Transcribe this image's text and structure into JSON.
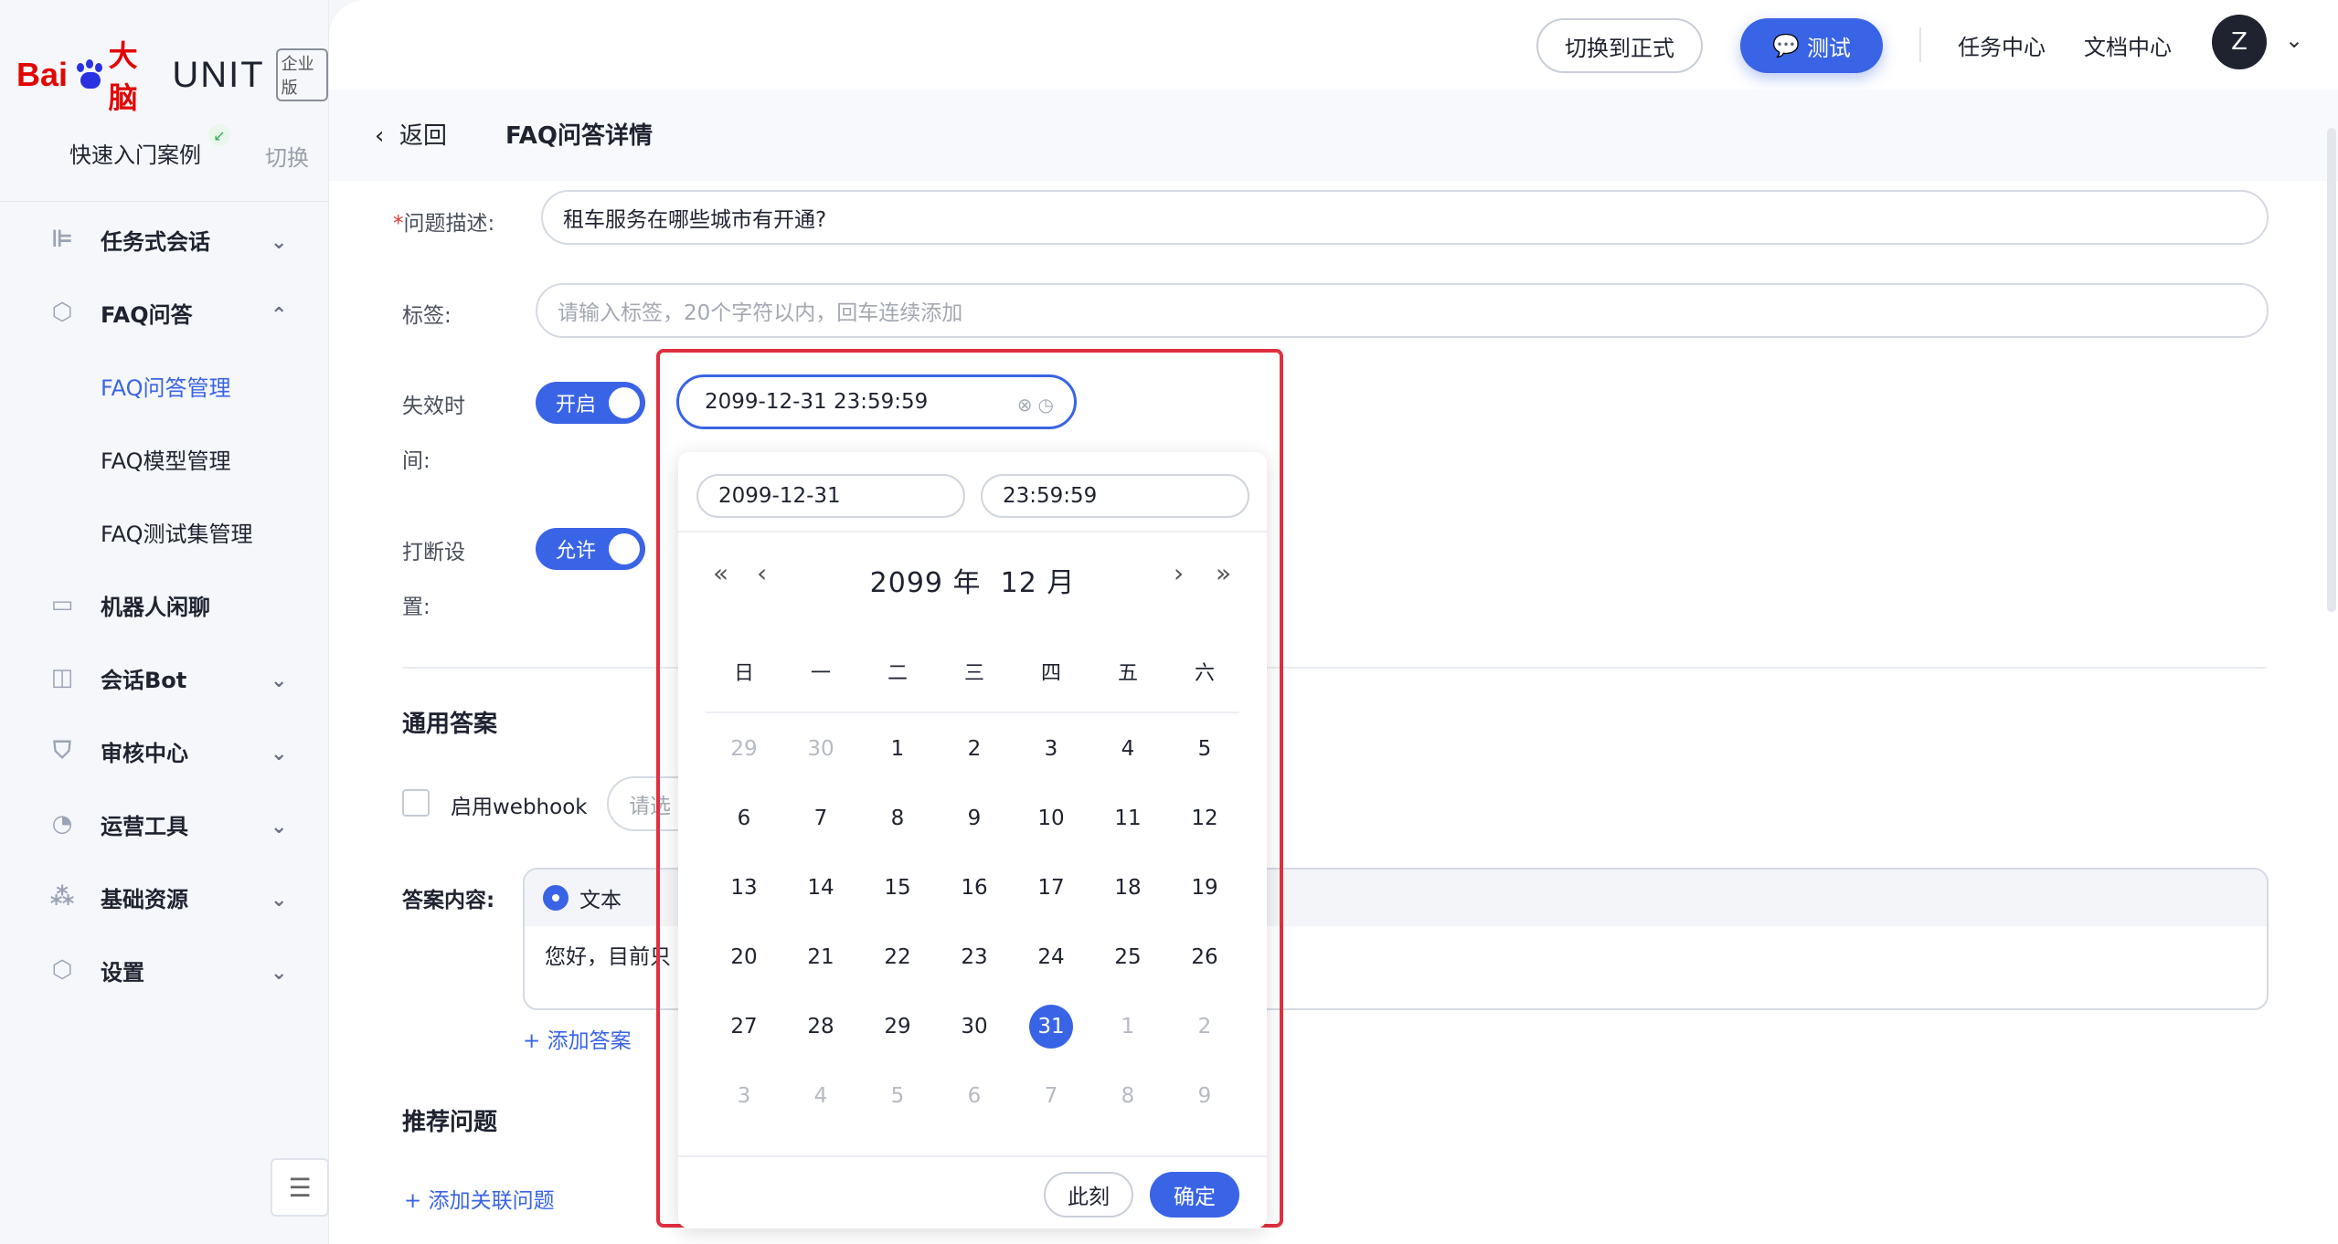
{
  "brand": {
    "bai": "Bai",
    "du": "du",
    "brain": "大脑",
    "unit": "UNIT",
    "edition": "企业版"
  },
  "sidebar": {
    "quick_start": "快速入门案例",
    "switch": "切换",
    "items": [
      {
        "label": "任务式会话",
        "icon": "tree-icon"
      },
      {
        "label": "FAQ问答",
        "icon": "question-icon"
      },
      {
        "label": "FAQ问答管理",
        "sub": true,
        "active": true
      },
      {
        "label": "FAQ模型管理",
        "sub": true
      },
      {
        "label": "FAQ测试集管理",
        "sub": true
      },
      {
        "label": "机器人闲聊",
        "icon": "chat-icon"
      },
      {
        "label": "会话Bot",
        "icon": "bot-icon"
      },
      {
        "label": "审核中心",
        "icon": "shield-icon"
      },
      {
        "label": "运营工具",
        "icon": "tool-icon"
      },
      {
        "label": "基础资源",
        "icon": "cubes-icon"
      },
      {
        "label": "设置",
        "icon": "settings-icon"
      }
    ]
  },
  "topbar": {
    "switch_formal": "切换到正式",
    "test": "测试",
    "task_center": "任务中心",
    "doc_center": "文档中心",
    "avatar_letter": "Z"
  },
  "header": {
    "back": "返回",
    "title": "FAQ问答详情"
  },
  "form": {
    "question_label": "问题描述:",
    "question_value": "租车服务在哪些城市有开通?",
    "tags_label": "标签:",
    "tags_placeholder": "请输入标签，20个字符以内，回车连续添加",
    "expire_label_1": "失效时",
    "expire_label_2": "间:",
    "expire_toggle": "开启",
    "interrupt_label_1": "打断设",
    "interrupt_label_2": "置:",
    "interrupt_toggle": "允许",
    "datetime_value": "2099-12-31 23:59:59"
  },
  "answers": {
    "section_title": "通用答案",
    "webhook_label": "启用webhook",
    "webhook_select_partial": "请选",
    "content_label": "答案内容:",
    "type_text": "文本",
    "content_partial": "您好，目前只",
    "add_answer": "+ 添加答案"
  },
  "recommend": {
    "section_title": "推荐问题",
    "add_related": "+ 添加关联问题"
  },
  "picker": {
    "date_input": "2099-12-31",
    "time_input": "23:59:59",
    "year": "2099 年",
    "month": "12 月",
    "weekdays": [
      "日",
      "一",
      "二",
      "三",
      "四",
      "五",
      "六"
    ],
    "days": [
      [
        "29",
        "30",
        "1",
        "2",
        "3",
        "4",
        "5"
      ],
      [
        "6",
        "7",
        "8",
        "9",
        "10",
        "11",
        "12"
      ],
      [
        "13",
        "14",
        "15",
        "16",
        "17",
        "18",
        "19"
      ],
      [
        "20",
        "21",
        "22",
        "23",
        "24",
        "25",
        "26"
      ],
      [
        "27",
        "28",
        "29",
        "30",
        "31",
        "1",
        "2"
      ],
      [
        "3",
        "4",
        "5",
        "6",
        "7",
        "8",
        "9"
      ]
    ],
    "selected_day": "31",
    "now_button": "此刻",
    "ok_button": "确定"
  },
  "colors": {
    "accent": "#3a64e6",
    "highlight": "#e0303f",
    "brand_red": "#e10602"
  }
}
